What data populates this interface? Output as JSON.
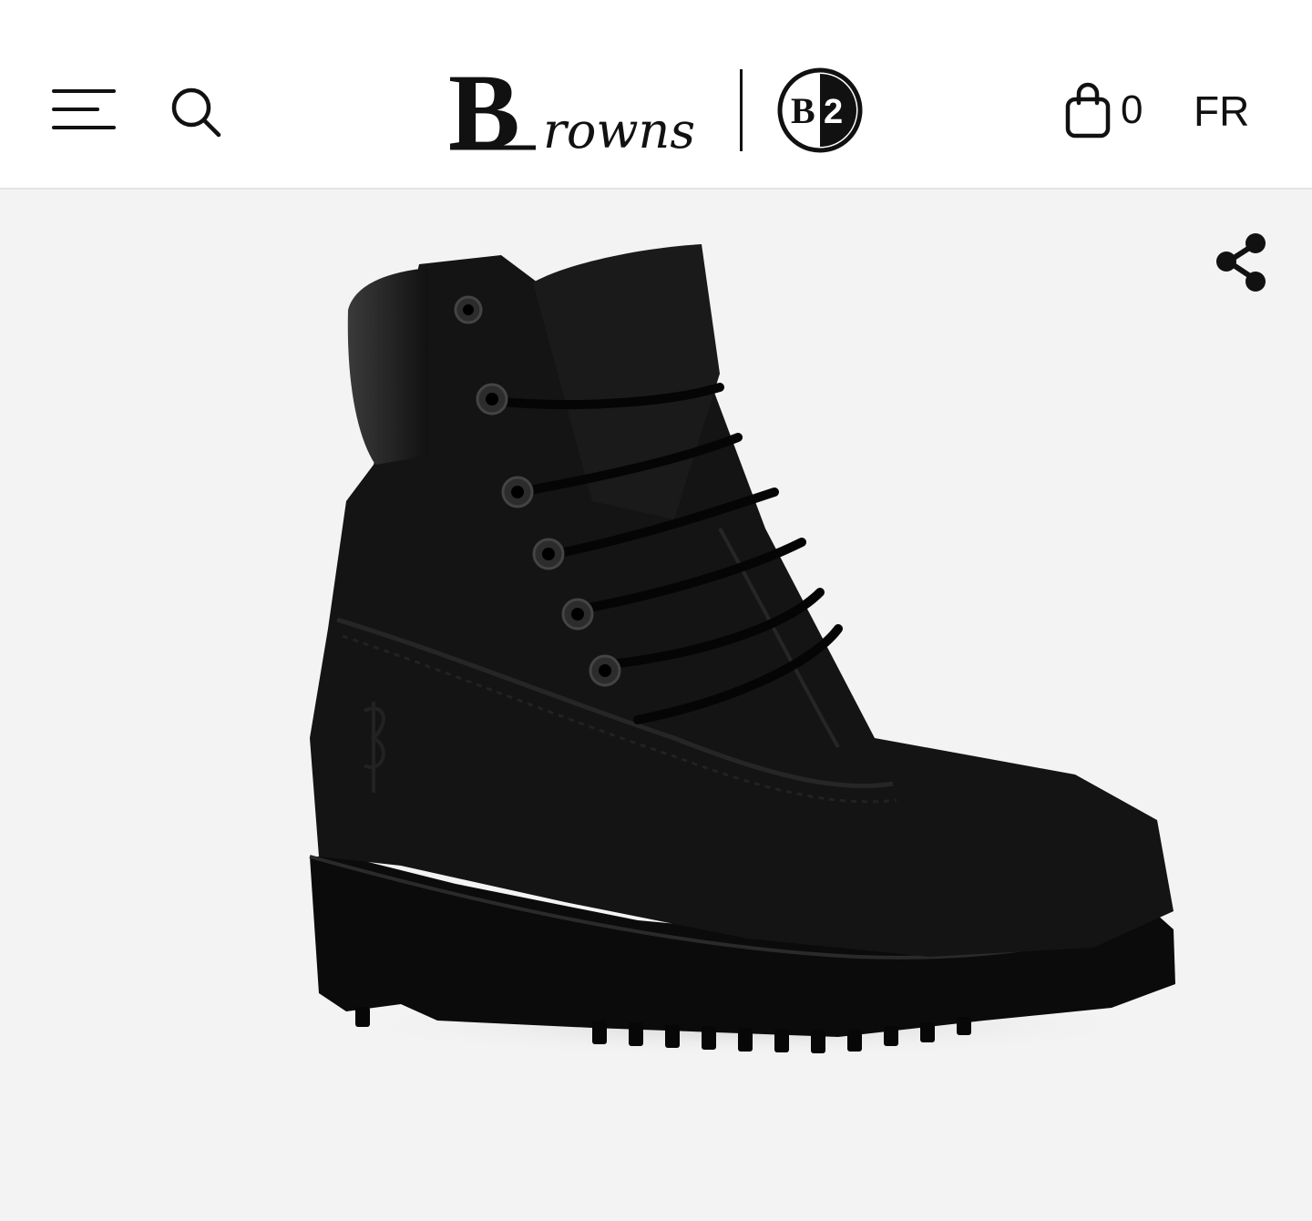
{
  "header": {
    "menu_icon": "hamburger-menu-icon",
    "search_icon": "search-icon",
    "logo": {
      "brand_text": "Browns",
      "secondary_badge_text": "B2"
    },
    "cart": {
      "icon": "shopping-bag-icon",
      "count": "0"
    },
    "language_label": "FR"
  },
  "gallery": {
    "share_icon": "share-icon",
    "product_image": "black-nubuck-lace-up-boot",
    "background_color": "#f3f3f3"
  }
}
